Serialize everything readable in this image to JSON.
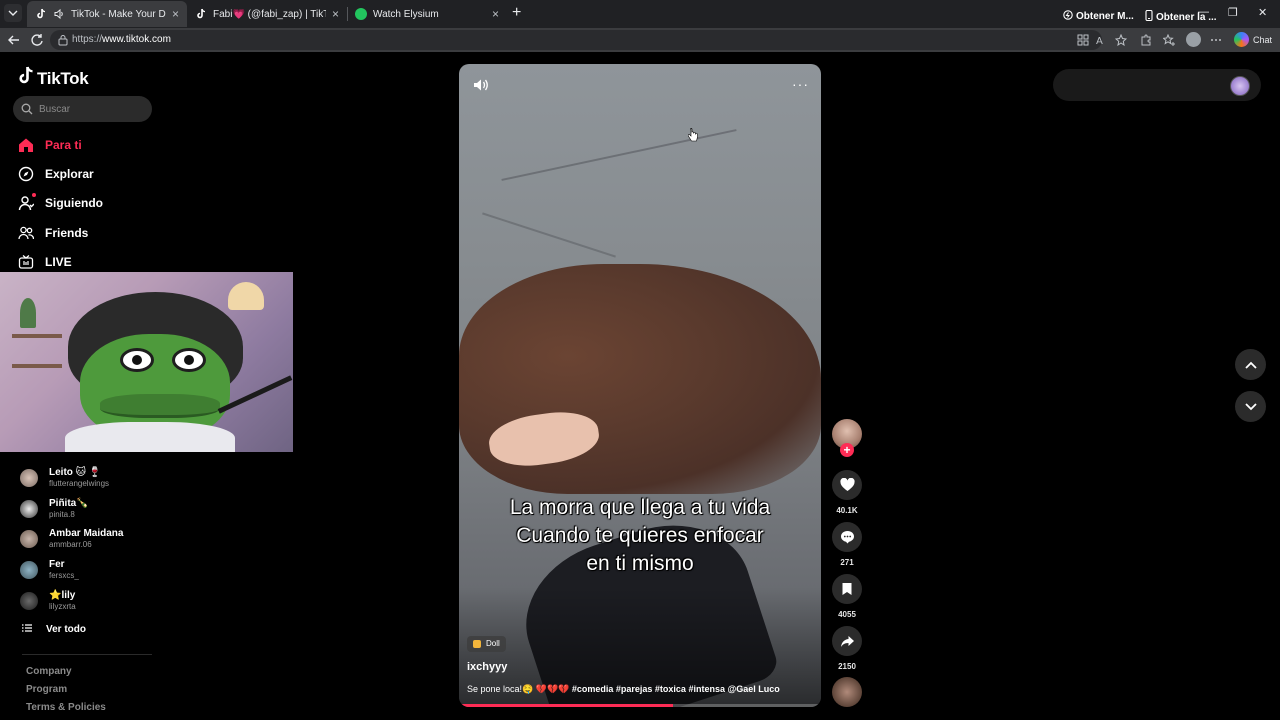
{
  "browser": {
    "tabs": [
      {
        "title": "TikTok - Make Your Day",
        "active": true
      },
      {
        "title": "Fabi💗 (@fabi_zap) | TikTok",
        "active": false
      },
      {
        "title": "Watch Elysium",
        "active": false
      }
    ],
    "url_prefix": "https://",
    "url_host": "www.tiktok.com",
    "chat_label": "Chat"
  },
  "sidebar": {
    "logo_text": "TikTok",
    "search_placeholder": "Buscar",
    "nav": [
      {
        "label": "Para ti",
        "icon": "home-icon",
        "active": true
      },
      {
        "label": "Explorar",
        "icon": "compass-icon"
      },
      {
        "label": "Siguiendo",
        "icon": "following-icon"
      },
      {
        "label": "Friends",
        "icon": "friends-icon"
      },
      {
        "label": "LIVE",
        "icon": "live-icon"
      }
    ],
    "following": [
      {
        "name": "Leito 🐱 🍷",
        "handle": "flutterangelwings"
      },
      {
        "name": "Piñita🍾",
        "handle": "pinita.8"
      },
      {
        "name": "Ambar Maidana",
        "handle": "ammbarr.06"
      },
      {
        "name": "Fer",
        "handle": "fersxcs_"
      },
      {
        "name": "⭐lily",
        "handle": "lilyzxrta"
      }
    ],
    "see_all": "Ver todo",
    "footer": [
      "Company",
      "Program",
      "Terms & Policies"
    ]
  },
  "video": {
    "caption_lines": [
      "La morra que llega a tu vida",
      "Cuando te quieres enfocar",
      "en ti mismo"
    ],
    "effect_label": "Doll",
    "author": "ixchyyy",
    "description": "Se pone loca!🤤 💔💔💔 ",
    "hashtags": "#comedia #parejas #toxica #intensa @Gael Luco",
    "progress": 0.59
  },
  "actions": {
    "likes": "40.1K",
    "comments": "271",
    "saves": "4055",
    "shares": "2150"
  },
  "topright": {
    "get_coins": "Obtener M...",
    "get_app": "Obtener la ..."
  },
  "colors": {
    "accent": "#fe2c55",
    "background": "#000000",
    "chrome": "#202124"
  }
}
